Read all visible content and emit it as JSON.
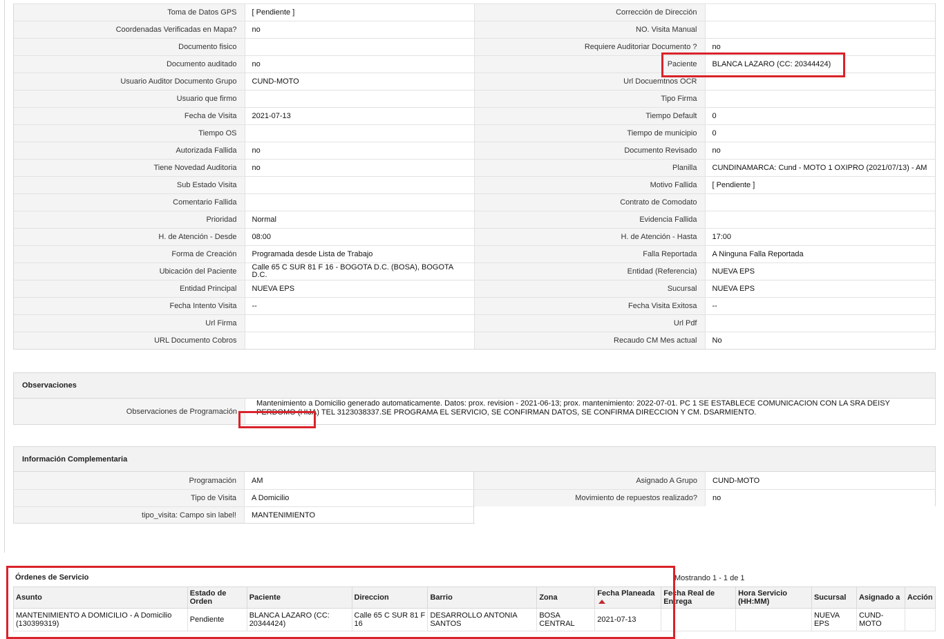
{
  "detail_rows": [
    {
      "l1": "Toma de Datos GPS",
      "v1": "[ Pendiente ]",
      "l2": "Corrección de Dirección",
      "v2": ""
    },
    {
      "l1": "Coordenadas Verificadas en Mapa?",
      "v1": "no",
      "l2": "NO. Visita Manual",
      "v2": ""
    },
    {
      "l1": "Documento fisico",
      "v1": "",
      "l2": "Requiere Auditoriar Documento ?",
      "v2": "no"
    },
    {
      "l1": "Documento auditado",
      "v1": "no",
      "l2": "Paciente",
      "v2": "BLANCA LAZARO (CC: 20344424)"
    },
    {
      "l1": "Usuario Auditor Documento Grupo",
      "v1": "CUND-MOTO",
      "l2": "Url Docuemtnos OCR",
      "v2": ""
    },
    {
      "l1": "Usuario que firmo",
      "v1": "",
      "l2": "Tipo Firma",
      "v2": ""
    },
    {
      "l1": "Fecha de Visita",
      "v1": "2021-07-13",
      "l2": "Tiempo Default",
      "v2": "0"
    },
    {
      "l1": "Tiempo OS",
      "v1": "",
      "l2": "Tiempo de municipio",
      "v2": "0"
    },
    {
      "l1": "Autorizada Fallida",
      "v1": "no",
      "l2": "Documento Revisado",
      "v2": "no"
    },
    {
      "l1": "Tiene Novedad Auditoria",
      "v1": "no",
      "l2": "Planilla",
      "v2": "CUNDINAMARCA: Cund - MOTO 1 OXIPRO (2021/07/13) - AM"
    },
    {
      "l1": "Sub Estado Visita",
      "v1": "",
      "l2": "Motivo Fallida",
      "v2": "[ Pendiente ]"
    },
    {
      "l1": "Comentario Fallida",
      "v1": "",
      "l2": "Contrato de Comodato",
      "v2": ""
    },
    {
      "l1": "Prioridad",
      "v1": "Normal",
      "l2": "Evidencia Fallida",
      "v2": ""
    },
    {
      "l1": "H. de Atención - Desde",
      "v1": "08:00",
      "l2": "H. de Atención - Hasta",
      "v2": "17:00"
    },
    {
      "l1": "Forma de Creación",
      "v1": "Programada desde Lista de Trabajo",
      "l2": "Falla Reportada",
      "v2": "A Ninguna Falla Reportada"
    },
    {
      "l1": "Ubicación del Paciente",
      "v1": "Calle 65 C SUR 81 F 16 - BOGOTA D.C. (BOSA), BOGOTA D.C.",
      "l2": "Entidad (Referencia)",
      "v2": "NUEVA EPS"
    },
    {
      "l1": "Entidad Principal",
      "v1": "NUEVA EPS",
      "l2": "Sucursal",
      "v2": "NUEVA EPS"
    },
    {
      "l1": "Fecha Intento Visita",
      "v1": "--",
      "l2": "Fecha Visita Exitosa",
      "v2": "--"
    },
    {
      "l1": "Url Firma",
      "v1": "",
      "l2": "Url Pdf",
      "v2": ""
    },
    {
      "l1": "URL Documento Cobros",
      "v1": "",
      "l2": "Recaudo CM Mes actual",
      "v2": "No"
    }
  ],
  "observaciones": {
    "title": "Observaciones",
    "label": "Observaciones de Programación",
    "text": "Mantenimiento a Domicilio generado automaticamente. Datos: prox. revision - 2021-06-13; prox. mantenimiento: 2022-07-01. PC 1 SE ESTABLECE COMUNICACION CON LA SRA DEISY PERDOMO (HIJA) TEL 3123038337.SE PROGRAMA EL SERVICIO, SE CONFIRMAN DATOS, SE CONFIRMA DIRECCION Y CM. DSARMIENTO."
  },
  "info": {
    "title": "Información Complementaria",
    "rows": [
      {
        "l1": "Programación",
        "v1": "AM",
        "l2": "Asignado A Grupo",
        "v2": "CUND-MOTO"
      },
      {
        "l1": "Tipo de Visita",
        "v1": "A Domicilio",
        "l2": "Movimiento de repuestos realizado?",
        "v2": "no"
      },
      {
        "l1": "tipo_visita: Campo sin label!",
        "v1": "MANTENIMIENTO"
      }
    ]
  },
  "orders": {
    "title": "Órdenes de Servicio",
    "showing": "Mostrando 1 - 1 de 1",
    "headers": [
      "Asunto",
      "Estado de Orden",
      "Paciente",
      "Direccion",
      "Barrio",
      "Zona",
      "Fecha Planeada",
      "Fecha Real de Entrega",
      "Hora Servicio (HH:MM)",
      "Sucursal",
      "Asignado a",
      "Acción"
    ],
    "rows": [
      [
        "MANTENIMIENTO A DOMICILIO - A Domicilio (130399319)",
        "Pendiente",
        "BLANCA LAZARO (CC: 20344424)",
        "Calle 65 C SUR 81 F 16",
        "DESARROLLO ANTONIA SANTOS",
        "BOSA CENTRAL",
        "2021-07-13",
        "",
        "",
        "NUEVA EPS",
        "CUND-MOTO",
        ""
      ]
    ]
  },
  "colors": {
    "highlight": "#d9222a",
    "sort_arrow": "#c0282d"
  }
}
